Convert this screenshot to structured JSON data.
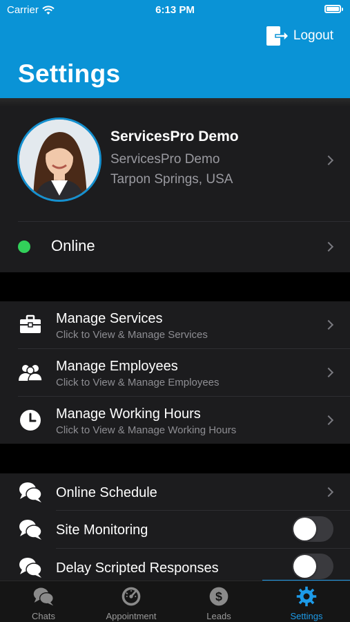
{
  "status_bar": {
    "carrier": "Carrier",
    "time": "6:13 PM"
  },
  "header": {
    "logout_label": "Logout",
    "title": "Settings"
  },
  "profile": {
    "name": "ServicesPro Demo",
    "company": "ServicesPro Demo",
    "location": "Tarpon Springs, USA"
  },
  "presence": {
    "label": "Online",
    "color": "#32d05a"
  },
  "manage_items": [
    {
      "title": "Manage Services",
      "subtitle": "Click to View & Manage Services",
      "icon": "briefcase-icon"
    },
    {
      "title": "Manage Employees",
      "subtitle": "Click to View & Manage Employees",
      "icon": "employees-icon"
    },
    {
      "title": "Manage Working Hours",
      "subtitle": "Click to View & Manage Working Hours",
      "icon": "clock-icon"
    }
  ],
  "chat_settings": [
    {
      "title": "Online Schedule",
      "icon": "chat-bubbles-icon"
    },
    {
      "title": "Site Monitoring",
      "icon": "chat-bubbles-icon",
      "toggle": false
    },
    {
      "title": "Delay Scripted Responses",
      "icon": "chat-bubbles-icon",
      "toggle": false
    }
  ],
  "tabs": [
    {
      "label": "Chats",
      "icon": "chat-bubbles-icon",
      "active": false
    },
    {
      "label": "Appointment",
      "icon": "speedometer-icon",
      "active": false
    },
    {
      "label": "Leads",
      "icon": "dollar-icon",
      "active": false
    },
    {
      "label": "Settings",
      "icon": "gear-icon",
      "active": true
    }
  ],
  "colors": {
    "header": "#0a93d6",
    "accent": "#1d9be9",
    "card": "#1c1c1e"
  }
}
